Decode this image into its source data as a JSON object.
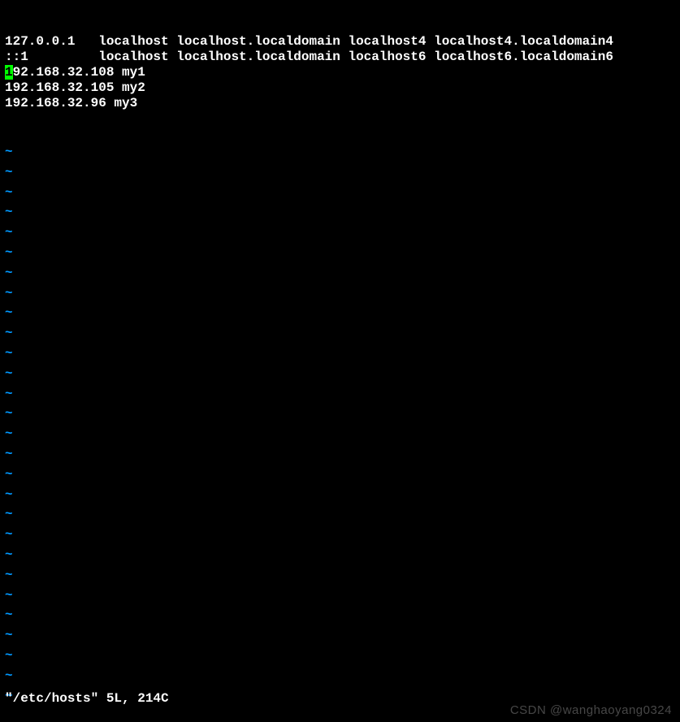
{
  "file": {
    "lines": [
      "127.0.0.1   localhost localhost.localdomain localhost4 localhost4.localdomain4",
      "::1         localhost localhost.localdomain localhost6 localhost6.localdomain6",
      "192.168.32.108 my1",
      "192.168.32.105 my2",
      "192.168.32.96 my3"
    ],
    "cursor_line_index": 2,
    "cursor_char_index": 0
  },
  "empty_line_marker": "~",
  "empty_line_count": 28,
  "status": "\"/etc/hosts\" 5L, 214C",
  "watermark": "CSDN @wanghaoyang0324"
}
